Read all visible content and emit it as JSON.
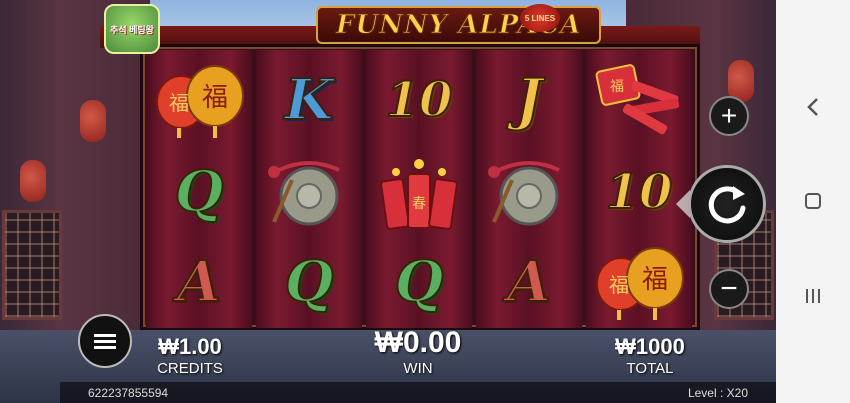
{
  "game": {
    "title": "FUNNY ALPACA",
    "lines_badge": "5 LINES",
    "event_logo_text": "추석 베팅왕"
  },
  "reels": [
    [
      {
        "symbol": "lantern-fu-icon",
        "kind": "icon"
      },
      {
        "symbol": "Q",
        "kind": "letter",
        "color": "green"
      },
      {
        "symbol": "A",
        "kind": "letter",
        "color": "red"
      }
    ],
    [
      {
        "symbol": "K",
        "kind": "letter",
        "color": "blue"
      },
      {
        "symbol": "gong-icon",
        "kind": "icon"
      },
      {
        "symbol": "Q",
        "kind": "letter",
        "color": "green"
      }
    ],
    [
      {
        "symbol": "10",
        "kind": "letter",
        "color": "gold"
      },
      {
        "symbol": "firecrackers-icon",
        "kind": "icon"
      },
      {
        "symbol": "Q",
        "kind": "letter",
        "color": "green"
      }
    ],
    [
      {
        "symbol": "J",
        "kind": "letter",
        "color": "gold"
      },
      {
        "symbol": "gong-icon",
        "kind": "icon"
      },
      {
        "symbol": "A",
        "kind": "letter",
        "color": "red"
      }
    ],
    [
      {
        "symbol": "firework-bundle-icon",
        "kind": "icon"
      },
      {
        "symbol": "10",
        "kind": "letter",
        "color": "gold"
      },
      {
        "symbol": "lantern-fu-icon",
        "kind": "icon"
      }
    ]
  ],
  "stats": {
    "credits_amount": "₩1.00",
    "credits_label": "CREDITS",
    "win_amount": "₩0.00",
    "win_label": "WIN",
    "total_amount": "₩1000",
    "total_label": "TOTAL"
  },
  "footer": {
    "session_id": "622237855594",
    "level": "Level :  X20"
  },
  "controls": {
    "plus": "+",
    "minus": "−"
  },
  "colors": {
    "gold": "#f2c14a",
    "blue": "#4c9ad8",
    "green": "#58b060",
    "red": "#d05a50"
  }
}
